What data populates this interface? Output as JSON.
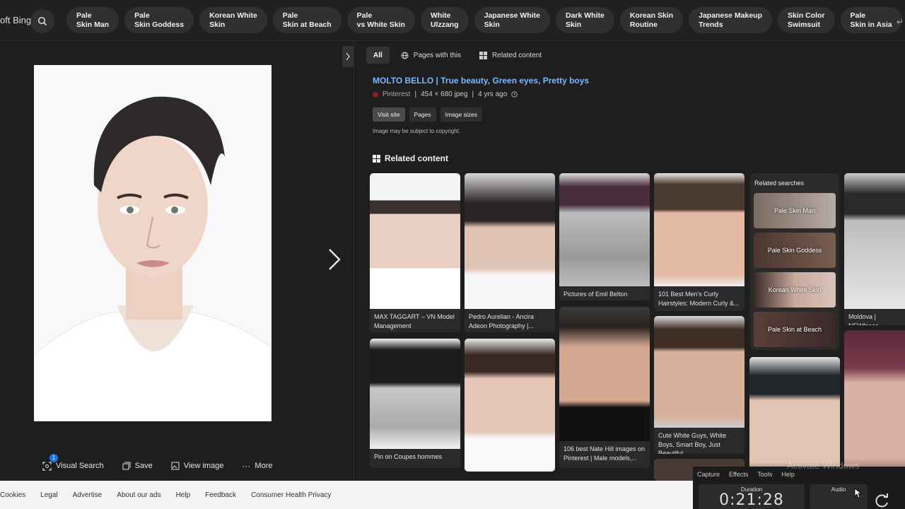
{
  "header": {
    "brand": "oft Bing",
    "chips": [
      {
        "l1": "Pale",
        "l2": "Skin Man"
      },
      {
        "l1": "Pale",
        "l2": "Skin Goddess"
      },
      {
        "l1": "Korean White",
        "l2": "Skin"
      },
      {
        "l1": "Pale",
        "l2": "Skin at Beach"
      },
      {
        "l1": "Pale",
        "l2": "vs White Skin"
      },
      {
        "l1": "White",
        "l2": "Ulzzang"
      },
      {
        "l1": "Japanese White",
        "l2": "Skin"
      },
      {
        "l1": "Dark White",
        "l2": "Skin"
      },
      {
        "l1": "Korean Skin",
        "l2": "Routine"
      },
      {
        "l1": "Japanese Makeup",
        "l2": "Trends"
      },
      {
        "l1": "Skin Color",
        "l2": "Swimsuit"
      },
      {
        "l1": "Pale",
        "l2": "Skin in Asia"
      }
    ]
  },
  "viewer": {
    "actions": {
      "visual_search": "Visual Search",
      "visual_search_badge": "1",
      "save": "Save",
      "view_image": "View image",
      "more": "More"
    }
  },
  "details": {
    "tabs": {
      "all": "All",
      "pages": "Pages with this",
      "related": "Related content"
    },
    "title": "MOLTO BELLO | True beauty, Green eyes, Pretty boys",
    "source": "Pinterest",
    "sep1": "|",
    "dims": "454 × 680 jpeg",
    "sep2": "|",
    "age": "4 yrs ago",
    "buttons": {
      "visit": "Visit site",
      "pages": "Pages",
      "sizes": "Image sizes"
    },
    "copyright": "Image may be subject to copyright.",
    "related_heading": "Related content"
  },
  "related": {
    "cards": [
      {
        "caption": "MAX TAGGART – VN Model Management"
      },
      {
        "caption": "Pedro Aurelian - Ancira Adeon Photography |..."
      },
      {
        "caption": "Pictures of Emil Belton"
      },
      {
        "caption": "101 Best Men's Curly Hairstyles: Modern Curly &..."
      },
      {
        "caption": "Moldova | NEWfaces"
      },
      {
        "caption": "Pin on Coupes hommes"
      },
      {
        "caption": ""
      },
      {
        "caption": "106 best Nate Hill images on Pinterest | Male models,..."
      },
      {
        "caption": "Cute White Guys, White Boys, Smart Boy, Just Beautiful..."
      }
    ],
    "searches_heading": "Related searches",
    "searches": [
      "Pale Skin Man",
      "Pale Skin Goddess",
      "Korean White Skin",
      "Pale Skin at Beach"
    ]
  },
  "footer": {
    "links": [
      "Cookies",
      "Legal",
      "Advertise",
      "About our ads",
      "Help",
      "Feedback",
      "Consumer Health Privacy"
    ]
  },
  "capture_tool": {
    "menu": [
      "Capture",
      "Effects",
      "Tools",
      "Help"
    ],
    "duration_label": "Duration",
    "duration": "0:21:28",
    "audio_label": "Audio"
  },
  "watermark": "Activate Windows"
}
